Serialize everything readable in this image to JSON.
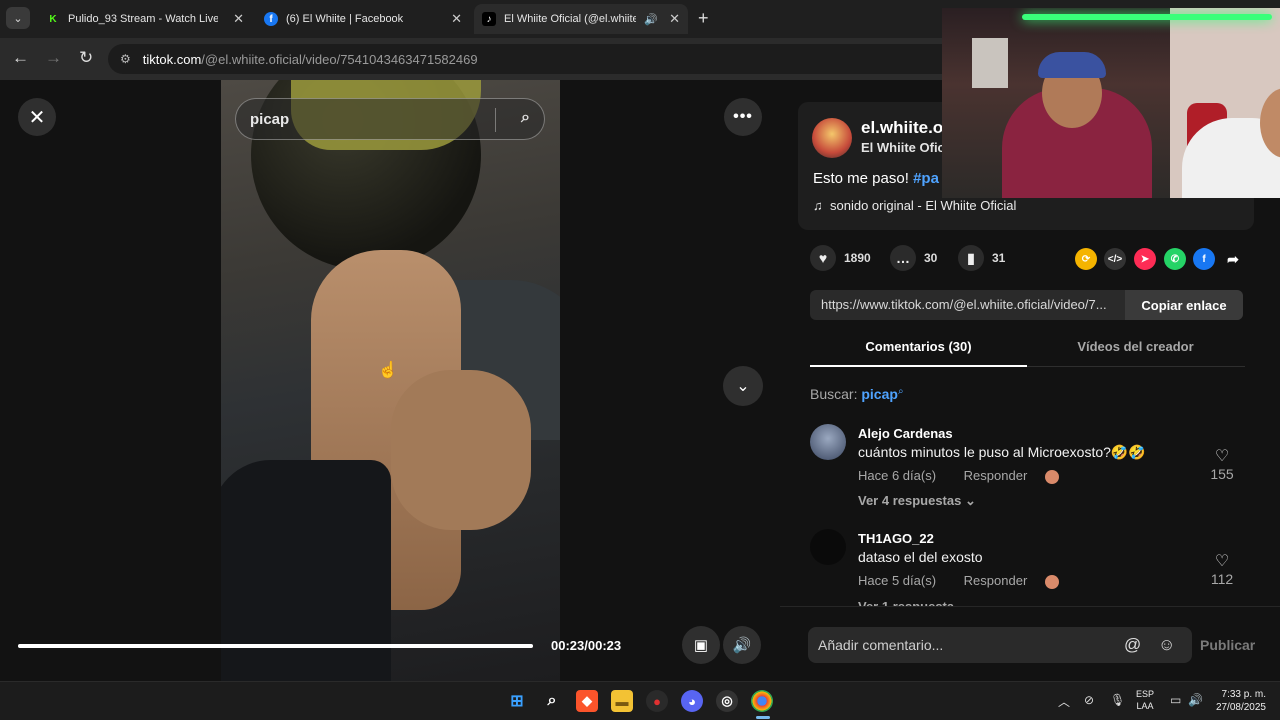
{
  "browser": {
    "tabs": [
      {
        "title": "Pulido_93 Stream - Watch Live on Kick",
        "favicon": "K",
        "favicon_color": "#53fc18"
      },
      {
        "title": "(6) El Whiite | Facebook",
        "favicon": "f",
        "favicon_color": "#1877f2"
      },
      {
        "title": "El Whiite Oficial (@el.whiite.oficial)",
        "favicon": "♪",
        "favicon_color": "#000000"
      }
    ],
    "url_host": "tiktok.com",
    "url_path": "/@el.whiite.oficial/video/7541043463471582469"
  },
  "video": {
    "search_value": "picap",
    "time": "00:23/00:23",
    "progress": 1.0
  },
  "author": {
    "username": "el.whiite.o",
    "nickname": "El Whiite Ofici",
    "caption": "Esto me paso! ",
    "caption_tag": "#pa",
    "sound": "sonido original - El Whiite Oficial"
  },
  "stats": {
    "likes": "1890",
    "comments": "30",
    "saves": "31"
  },
  "share_link": {
    "url": "https://www.tiktok.com/@el.whiite.oficial/video/7...",
    "copy_label": "Copiar enlace"
  },
  "panel_tabs": {
    "comments": "Comentarios (30)",
    "creator_videos": "Vídeos del creador"
  },
  "search_hint": {
    "label": "Buscar: ",
    "query": "picap"
  },
  "comments": [
    {
      "user": "Alejo Cardenas",
      "text": "cuántos minutos le puso al Microexosto?🤣🤣",
      "time": "Hace 6 día(s)",
      "reply": "Responder",
      "more": "Ver 4 respuestas ⌄",
      "likes": "155"
    },
    {
      "user": "TH1AGO_22",
      "text": "dataso el del exosto",
      "time": "Hace 5 día(s)",
      "reply": "Responder",
      "more": "Ver 1 respuesta",
      "likes": "112"
    }
  ],
  "composer": {
    "placeholder": "Añadir comentario...",
    "post_label": "Publicar"
  },
  "taskbar": {
    "lang_top": "ESP",
    "lang_bottom": "LAA",
    "time": "7:33 p. m.",
    "date": "27/08/2025"
  }
}
